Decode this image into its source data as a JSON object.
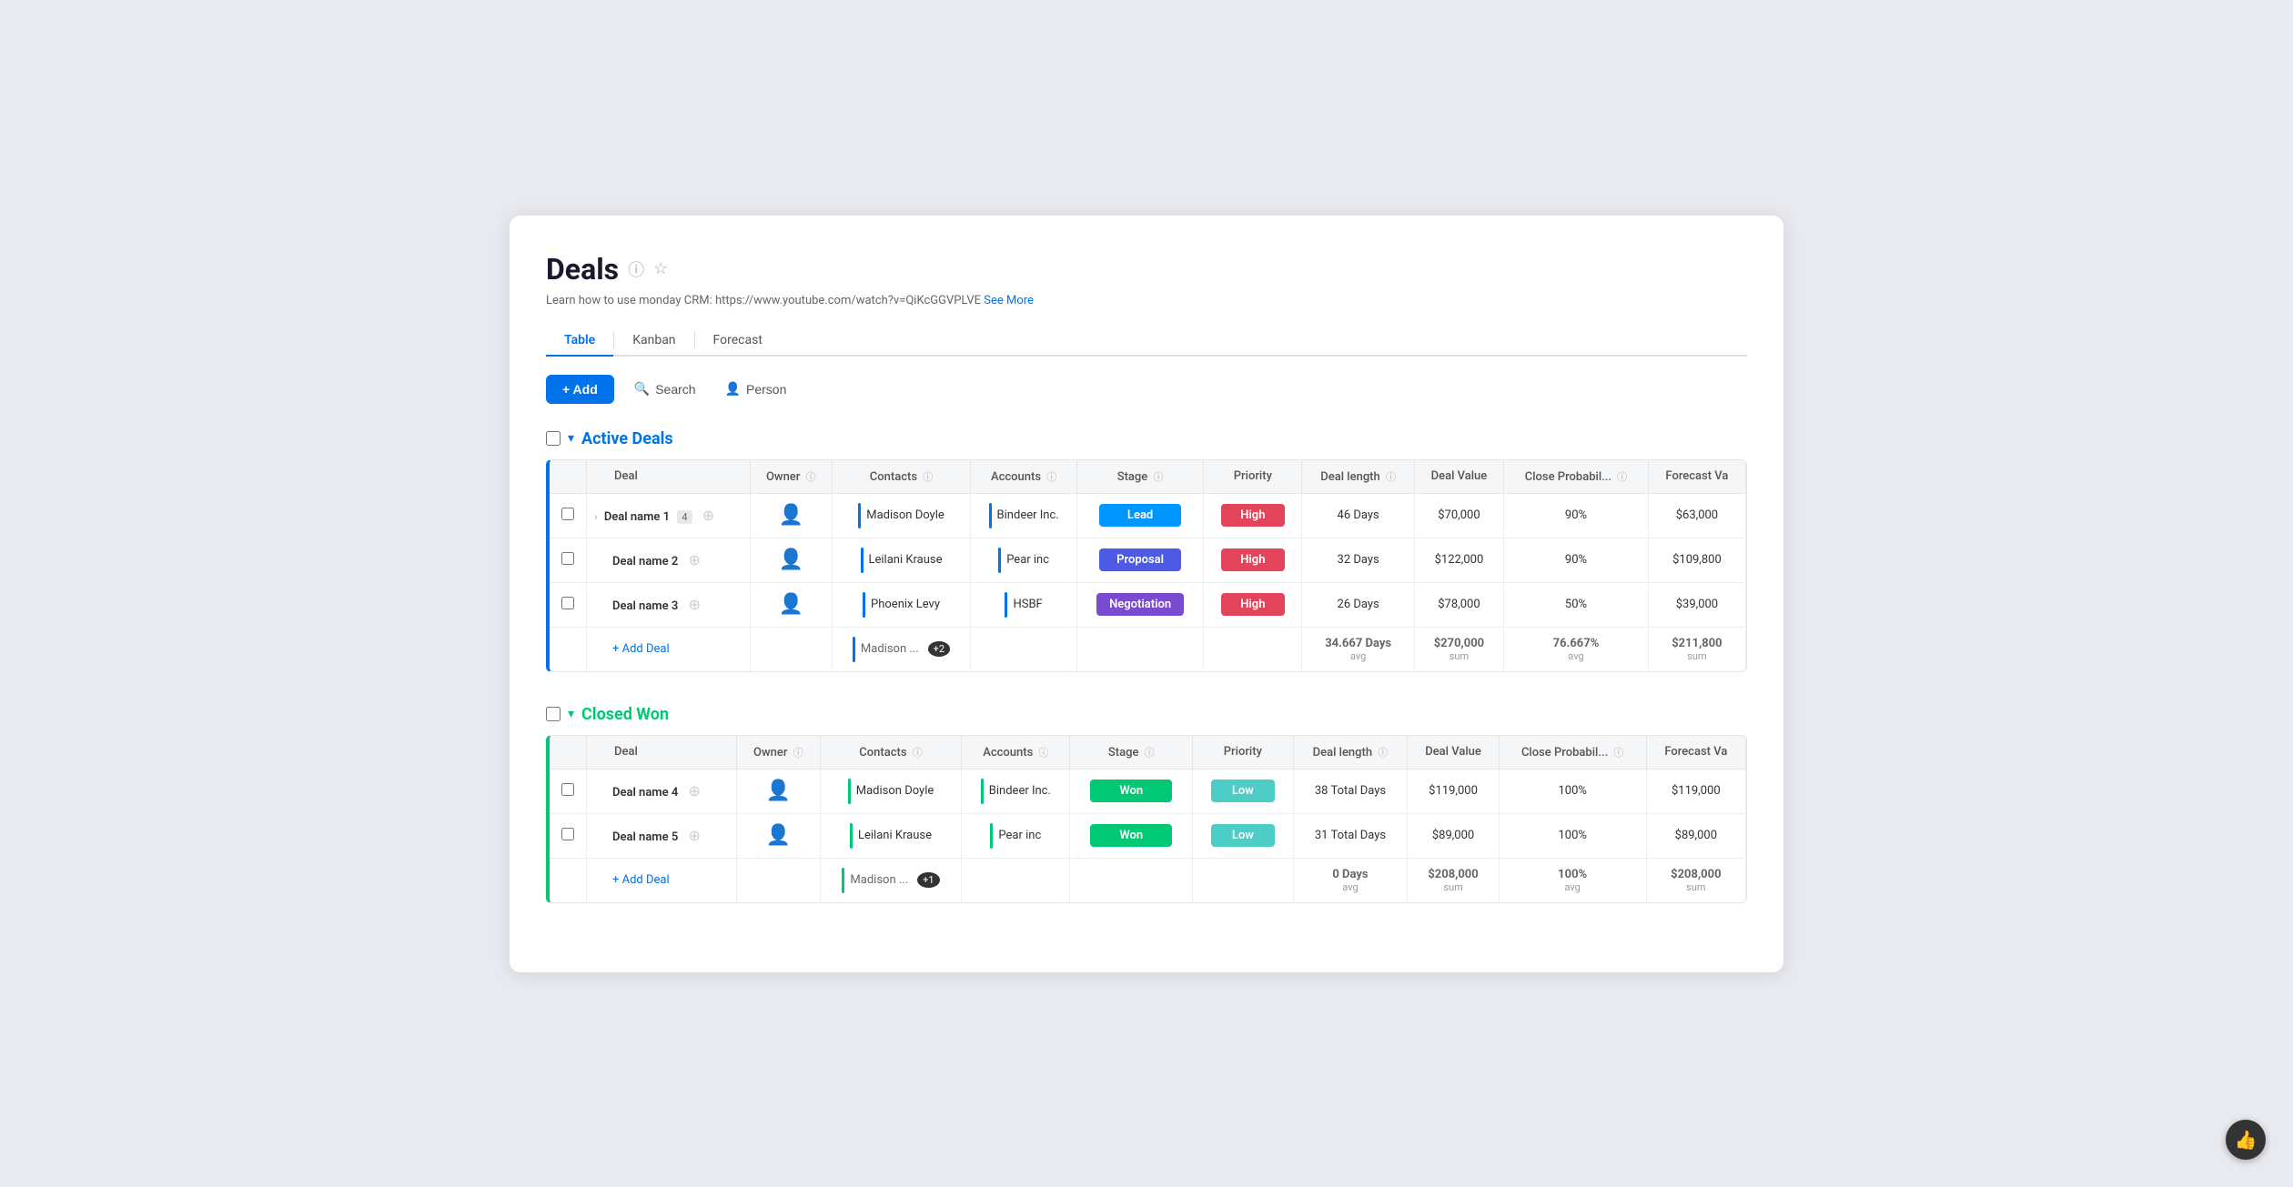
{
  "page": {
    "title": "Deals",
    "subtitle": "Learn how to use monday CRM: https://www.youtube.com/watch?v=QiKcGGVPLVE",
    "subtitle_link": "See More",
    "tabs": [
      {
        "id": "table",
        "label": "Table",
        "active": true
      },
      {
        "id": "kanban",
        "label": "Kanban",
        "active": false
      },
      {
        "id": "forecast",
        "label": "Forecast",
        "active": false
      }
    ],
    "toolbar": {
      "add_label": "+ Add",
      "search_label": "Search",
      "person_label": "Person"
    }
  },
  "active_deals": {
    "section_title": "Active Deals",
    "columns": [
      "Deal",
      "Owner",
      "Contacts",
      "Accounts",
      "Stage",
      "Priority",
      "Deal length",
      "Deal Value",
      "Close Probabil...",
      "Forecast Va"
    ],
    "rows": [
      {
        "deal": "Deal name 1",
        "sub_count": 4,
        "expandable": true,
        "contacts": "Madison Doyle",
        "accounts": "Bindeer Inc.",
        "stage": "Lead",
        "stage_class": "stage-lead",
        "priority": "High",
        "priority_class": "priority-high",
        "deal_length": "46 Days",
        "deal_value": "$70,000",
        "close_prob": "90%",
        "forecast_val": "$63,000"
      },
      {
        "deal": "Deal name 2",
        "sub_count": null,
        "expandable": false,
        "contacts": "Leilani Krause",
        "accounts": "Pear inc",
        "stage": "Proposal",
        "stage_class": "stage-proposal",
        "priority": "High",
        "priority_class": "priority-high",
        "deal_length": "32 Days",
        "deal_value": "$122,000",
        "close_prob": "90%",
        "forecast_val": "$109,800"
      },
      {
        "deal": "Deal name 3",
        "sub_count": null,
        "expandable": false,
        "contacts": "Phoenix Levy",
        "accounts": "HSBF",
        "stage": "Negotiation",
        "stage_class": "stage-negotiation",
        "priority": "High",
        "priority_class": "priority-high",
        "deal_length": "26 Days",
        "deal_value": "$78,000",
        "close_prob": "50%",
        "forecast_val": "$39,000"
      }
    ],
    "add_deal_label": "+ Add Deal",
    "footer_contacts": "Madison ...",
    "footer_contacts_badge": "+2",
    "summary": {
      "deal_length_val": "34.667 Days",
      "deal_length_label": "avg",
      "deal_value_val": "$270,000",
      "deal_value_label": "sum",
      "close_prob_val": "76.667%",
      "close_prob_label": "avg",
      "forecast_val_val": "$211,800",
      "forecast_val_label": "sum"
    }
  },
  "closed_won": {
    "section_title": "Closed Won",
    "columns": [
      "Deal",
      "Owner",
      "Contacts",
      "Accounts",
      "Stage",
      "Priority",
      "Deal length",
      "Deal Value",
      "Close Probabil...",
      "Forecast Va"
    ],
    "rows": [
      {
        "deal": "Deal name 4",
        "expandable": false,
        "contacts": "Madison Doyle",
        "accounts": "Bindeer Inc.",
        "stage": "Won",
        "stage_class": "stage-won",
        "priority": "Low",
        "priority_class": "priority-low",
        "deal_length": "38 Total Days",
        "deal_value": "$119,000",
        "close_prob": "100%",
        "forecast_val": "$119,000"
      },
      {
        "deal": "Deal name 5",
        "expandable": false,
        "contacts": "Leilani Krause",
        "accounts": "Pear inc",
        "stage": "Won",
        "stage_class": "stage-won",
        "priority": "Low",
        "priority_class": "priority-low",
        "deal_length": "31 Total Days",
        "deal_value": "$89,000",
        "close_prob": "100%",
        "forecast_val": "$89,000"
      }
    ],
    "add_deal_label": "+ Add Deal",
    "footer_contacts": "Madison ...",
    "footer_contacts_badge": "+1",
    "summary": {
      "deal_length_val": "0 Days",
      "deal_length_label": "avg",
      "deal_value_val": "$208,000",
      "deal_value_label": "sum",
      "close_prob_val": "100%",
      "close_prob_label": "avg",
      "forecast_val_val": "$208,000",
      "forecast_val_label": "sum"
    }
  }
}
